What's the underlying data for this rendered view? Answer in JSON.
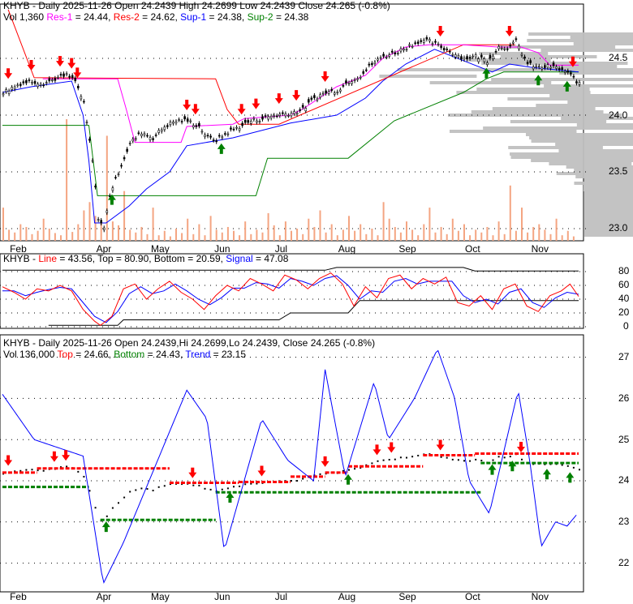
{
  "panel1": {
    "line1": "KHYB - Daily 2025-11-26 Open 24.2439  High 24.2699  Low 24.2439  Close 24.265 (-0.8%)",
    "vol": "Vol 1,360",
    "res1": "Res-1",
    "res1v": " = 24.44, ",
    "res2": "Res-2",
    "res2v": " = 24.62, ",
    "sup1": "Sup-1",
    "sup1v": " = 24.38, ",
    "sup2": "Sup-2",
    "sup2v": " = 24.38",
    "ticks": [
      "24.5",
      "24.0",
      "23.5",
      "23.0"
    ]
  },
  "panel2": {
    "pre": "KHYB - ",
    "line": "Line",
    "linev": " = 43.56, Top = 80.90, Bottom = 20.59, ",
    "signal": "Signal",
    "signalv": " = 47.08",
    "ticks": [
      "80",
      "60",
      "40",
      "20",
      "0"
    ]
  },
  "panel3": {
    "line1": "KHYB - Daily 2025-11-26 Open 24.2439,Hi 24.2699,Lo 24.2439, Close 24.265 (-0.8%)",
    "vol": "Vol 136,000 ",
    "top": "Top",
    "topv": " = 24.66, ",
    "bottom": "Bottom",
    "bottomv": " = 24.43, ",
    "trend": "Trend",
    "trendv": " = 23.15",
    "ticks": [
      "27",
      "26",
      "25",
      "24",
      "23",
      "22"
    ]
  },
  "months": [
    "Feb",
    "Apr",
    "May",
    "Jun",
    "Jul",
    "Aug",
    "Sep",
    "Oct",
    "Nov"
  ],
  "colors": {
    "res1": "#ff00ff",
    "res2": "#ff0000",
    "sup1": "#0000ff",
    "sup2": "#008000",
    "volume": "#f4a582",
    "profile": "#c0c0c0"
  },
  "chart_data": {
    "type": "line",
    "title": "KHYB - Daily 2025-11-26",
    "x_unit": "time index 0-100 (Feb 1 to Nov 26)",
    "month_ticks": [
      1,
      16,
      25.5,
      36.5,
      47,
      58,
      68.5,
      80,
      91.5
    ],
    "price_ylim": [
      22.9,
      24.85
    ],
    "price": [
      [
        0,
        24.2
      ],
      [
        3,
        24.28
      ],
      [
        5,
        24.3
      ],
      [
        7,
        24.28
      ],
      [
        9,
        24.32
      ],
      [
        11,
        24.35
      ],
      [
        12.5,
        24.3
      ],
      [
        14,
        24.1
      ],
      [
        15.5,
        23.6
      ],
      [
        16.5,
        23.1
      ],
      [
        17.5,
        23.0
      ],
      [
        18.5,
        23.3
      ],
      [
        20,
        23.5
      ],
      [
        22,
        23.75
      ],
      [
        24,
        23.85
      ],
      [
        26,
        23.8
      ],
      [
        28,
        23.9
      ],
      [
        30,
        23.95
      ],
      [
        32,
        23.95
      ],
      [
        34,
        23.9
      ],
      [
        35.5,
        23.8
      ],
      [
        37,
        23.78
      ],
      [
        39,
        23.85
      ],
      [
        41,
        23.9
      ],
      [
        43,
        23.95
      ],
      [
        45,
        23.97
      ],
      [
        47,
        24.0
      ],
      [
        50,
        24.02
      ],
      [
        52,
        24.05
      ],
      [
        54,
        24.15
      ],
      [
        56,
        24.2
      ],
      [
        58,
        24.22
      ],
      [
        60,
        24.3
      ],
      [
        62,
        24.35
      ],
      [
        64,
        24.45
      ],
      [
        66,
        24.52
      ],
      [
        68,
        24.55
      ],
      [
        70,
        24.6
      ],
      [
        72,
        24.65
      ],
      [
        74,
        24.65
      ],
      [
        76,
        24.6
      ],
      [
        78,
        24.55
      ],
      [
        80,
        24.5
      ],
      [
        82,
        24.52
      ],
      [
        84,
        24.48
      ],
      [
        86,
        24.6
      ],
      [
        88,
        24.6
      ],
      [
        89,
        24.65
      ],
      [
        91,
        24.45
      ],
      [
        93,
        24.42
      ],
      [
        95,
        24.43
      ],
      [
        97,
        24.4
      ],
      [
        99,
        24.33
      ],
      [
        100,
        24.27
      ]
    ],
    "res1": [
      [
        7,
        24.32
      ],
      [
        20,
        24.32
      ],
      [
        21.5,
        24.05
      ],
      [
        23,
        23.76
      ],
      [
        31,
        23.76
      ],
      [
        32,
        23.9
      ],
      [
        40,
        23.92
      ],
      [
        42,
        23.97
      ],
      [
        50,
        24.0
      ],
      [
        52,
        24.05
      ],
      [
        55,
        24.15
      ],
      [
        58,
        24.25
      ],
      [
        63,
        24.35
      ],
      [
        66,
        24.5
      ],
      [
        70,
        24.6
      ],
      [
        74,
        24.62
      ],
      [
        80,
        24.62
      ],
      [
        86,
        24.6
      ],
      [
        90,
        24.6
      ],
      [
        93,
        24.55
      ],
      [
        95,
        24.44
      ],
      [
        100,
        24.44
      ]
    ],
    "res2": [
      [
        1,
        24.93
      ],
      [
        5.5,
        24.33
      ],
      [
        37,
        24.32
      ],
      [
        39,
        24.05
      ],
      [
        41,
        23.92
      ],
      [
        48,
        23.92
      ],
      [
        80,
        24.62
      ],
      [
        89,
        24.62
      ]
    ],
    "sup1": [
      [
        0,
        24.2
      ],
      [
        5,
        24.25
      ],
      [
        12,
        24.3
      ],
      [
        14,
        24.0
      ],
      [
        15,
        23.6
      ],
      [
        16,
        23.05
      ],
      [
        18,
        23.05
      ],
      [
        22,
        23.2
      ],
      [
        25,
        23.35
      ],
      [
        29,
        23.5
      ],
      [
        32,
        23.73
      ],
      [
        40,
        23.8
      ],
      [
        50,
        23.93
      ],
      [
        58,
        24.0
      ],
      [
        63,
        24.15
      ],
      [
        66,
        24.3
      ],
      [
        70,
        24.45
      ],
      [
        75,
        24.58
      ],
      [
        80,
        24.48
      ],
      [
        85,
        24.38
      ],
      [
        88,
        24.45
      ],
      [
        92,
        24.42
      ],
      [
        100,
        24.38
      ]
    ],
    "sup2": [
      [
        0,
        23.91
      ],
      [
        15,
        23.91
      ],
      [
        16.5,
        23.29
      ],
      [
        44,
        23.29
      ],
      [
        46,
        23.62
      ],
      [
        60,
        23.62
      ],
      [
        68,
        23.95
      ],
      [
        80,
        24.2
      ],
      [
        84,
        24.32
      ],
      [
        87,
        24.38
      ],
      [
        100,
        24.38
      ]
    ],
    "res_arrows": [
      1,
      5,
      10,
      12,
      13,
      32,
      33.5,
      41.5,
      44,
      48,
      51,
      56,
      76,
      88,
      99
    ],
    "sup_arrows": [
      19,
      38,
      84,
      93,
      98
    ],
    "volume_x_step": 1,
    "volume": [
      60,
      20,
      15,
      30,
      25,
      12,
      18,
      40,
      22,
      14,
      10,
      220,
      16,
      30,
      55,
      70,
      45,
      38,
      190,
      35,
      28,
      90,
      20,
      15,
      25,
      12,
      60,
      10,
      18,
      8,
      22,
      14,
      40,
      12,
      30,
      10,
      45,
      20,
      15,
      25,
      18,
      10,
      35,
      12,
      20,
      15,
      50,
      28,
      10,
      35,
      18,
      22,
      12,
      40,
      25,
      55,
      15,
      30,
      10,
      20,
      45,
      18,
      30,
      12,
      22,
      10,
      70,
      40,
      25,
      15,
      35,
      20,
      10,
      30,
      60,
      15,
      25,
      12,
      40,
      18,
      30,
      10,
      20,
      15,
      25,
      10,
      35,
      12,
      100,
      18,
      60,
      15,
      25,
      30,
      20,
      12,
      40,
      10,
      18,
      8
    ],
    "stoch_line": [
      [
        0,
        58
      ],
      [
        2,
        50
      ],
      [
        4,
        40
      ],
      [
        6,
        55
      ],
      [
        8,
        52
      ],
      [
        10,
        60
      ],
      [
        12,
        52
      ],
      [
        14,
        25
      ],
      [
        16,
        8
      ],
      [
        17,
        2
      ],
      [
        19,
        15
      ],
      [
        21,
        55
      ],
      [
        23,
        62
      ],
      [
        25,
        40
      ],
      [
        27,
        55
      ],
      [
        29,
        66
      ],
      [
        31,
        50
      ],
      [
        33,
        40
      ],
      [
        35,
        25
      ],
      [
        37,
        45
      ],
      [
        39,
        60
      ],
      [
        41,
        52
      ],
      [
        43,
        70
      ],
      [
        45,
        62
      ],
      [
        47,
        52
      ],
      [
        49,
        75
      ],
      [
        51,
        68
      ],
      [
        53,
        55
      ],
      [
        55,
        70
      ],
      [
        57,
        78
      ],
      [
        59,
        62
      ],
      [
        61,
        30
      ],
      [
        63,
        58
      ],
      [
        65,
        42
      ],
      [
        67,
        70
      ],
      [
        69,
        75
      ],
      [
        71,
        55
      ],
      [
        73,
        70
      ],
      [
        75,
        62
      ],
      [
        77,
        72
      ],
      [
        79,
        35
      ],
      [
        81,
        30
      ],
      [
        83,
        45
      ],
      [
        85,
        25
      ],
      [
        87,
        55
      ],
      [
        89,
        62
      ],
      [
        91,
        30
      ],
      [
        93,
        22
      ],
      [
        95,
        45
      ],
      [
        97,
        52
      ],
      [
        98.5,
        62
      ],
      [
        100,
        44
      ]
    ],
    "stoch_signal": [
      [
        0,
        52
      ],
      [
        2,
        52
      ],
      [
        4,
        45
      ],
      [
        6,
        50
      ],
      [
        8,
        54
      ],
      [
        10,
        57
      ],
      [
        12,
        55
      ],
      [
        14,
        35
      ],
      [
        16,
        15
      ],
      [
        18,
        6
      ],
      [
        20,
        22
      ],
      [
        22,
        48
      ],
      [
        24,
        58
      ],
      [
        26,
        48
      ],
      [
        28,
        52
      ],
      [
        30,
        62
      ],
      [
        32,
        52
      ],
      [
        34,
        40
      ],
      [
        36,
        32
      ],
      [
        38,
        42
      ],
      [
        40,
        56
      ],
      [
        42,
        56
      ],
      [
        44,
        64
      ],
      [
        46,
        62
      ],
      [
        48,
        56
      ],
      [
        50,
        70
      ],
      [
        52,
        66
      ],
      [
        54,
        60
      ],
      [
        56,
        70
      ],
      [
        58,
        74
      ],
      [
        60,
        60
      ],
      [
        62,
        40
      ],
      [
        64,
        52
      ],
      [
        66,
        50
      ],
      [
        68,
        66
      ],
      [
        70,
        70
      ],
      [
        72,
        62
      ],
      [
        74,
        66
      ],
      [
        76,
        66
      ],
      [
        78,
        66
      ],
      [
        80,
        45
      ],
      [
        82,
        35
      ],
      [
        84,
        40
      ],
      [
        86,
        33
      ],
      [
        88,
        50
      ],
      [
        90,
        55
      ],
      [
        92,
        35
      ],
      [
        94,
        28
      ],
      [
        96,
        42
      ],
      [
        98,
        50
      ],
      [
        100,
        47
      ]
    ],
    "stoch_top": [
      [
        0,
        82
      ],
      [
        56,
        82
      ],
      [
        58,
        86
      ],
      [
        80,
        86
      ],
      [
        82,
        80.9
      ],
      [
        100,
        80.9
      ]
    ],
    "stoch_bottom": [
      [
        8,
        2
      ],
      [
        20,
        2
      ],
      [
        21,
        10
      ],
      [
        48,
        10
      ],
      [
        50,
        20
      ],
      [
        60,
        20
      ],
      [
        62,
        38
      ],
      [
        100,
        38
      ],
      [
        78,
        20.6
      ],
      [
        100,
        20.6
      ]
    ],
    "trend": [
      [
        0,
        26.1
      ],
      [
        5.5,
        25.0
      ],
      [
        14,
        24.6
      ],
      [
        17.5,
        21.5
      ],
      [
        21,
        22.5
      ],
      [
        32,
        26.2
      ],
      [
        35.5,
        25.5
      ],
      [
        38.5,
        22.3
      ],
      [
        45,
        25.5
      ],
      [
        49.5,
        24.5
      ],
      [
        54,
        24.0
      ],
      [
        56,
        26.7
      ],
      [
        59.5,
        24.1
      ],
      [
        64.5,
        26.4
      ],
      [
        67,
        25.0
      ],
      [
        71.5,
        26.0
      ],
      [
        75.5,
        27.2
      ],
      [
        78.5,
        26.0
      ],
      [
        81,
        24.0
      ],
      [
        84.5,
        23.2
      ],
      [
        87.5,
        25.0
      ],
      [
        89.5,
        26.2
      ],
      [
        91.5,
        24.5
      ],
      [
        93.5,
        22.4
      ],
      [
        96,
        23.0
      ],
      [
        98,
        22.9
      ],
      [
        99.8,
        23.2
      ]
    ],
    "top_segments": [
      [
        0,
        6,
        24.2
      ],
      [
        6,
        29,
        24.3
      ],
      [
        29,
        41,
        23.95
      ],
      [
        41,
        50,
        23.97
      ],
      [
        50,
        56,
        24.1
      ],
      [
        56,
        60,
        24.2
      ],
      [
        60,
        73,
        24.35
      ],
      [
        73,
        82,
        24.62
      ],
      [
        82,
        100,
        24.66
      ]
    ],
    "bottom_segments": [
      [
        0,
        15,
        23.85
      ],
      [
        17,
        37,
        23.05
      ],
      [
        37,
        83,
        23.72
      ],
      [
        83,
        100,
        24.43
      ]
    ],
    "p3_res_arrows": [
      1,
      9,
      11,
      33,
      45,
      56,
      65,
      67.5,
      76,
      90
    ],
    "p3_sup_arrows": [
      18,
      39.5,
      60,
      85,
      88.5,
      94.5,
      98.5
    ]
  }
}
